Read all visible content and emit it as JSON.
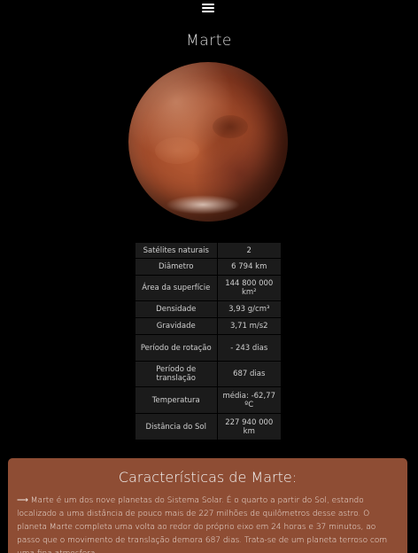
{
  "header": {
    "menu_icon": "hamburger-menu-icon"
  },
  "page": {
    "title": "Marte"
  },
  "planet_image": {
    "alt": "Marte"
  },
  "facts": [
    {
      "label": "Satélites naturais",
      "value": "2"
    },
    {
      "label": "Diâmetro",
      "value": "6 794 km"
    },
    {
      "label": "Área da superfície",
      "value": "144 800 000 km²"
    },
    {
      "label": "Densidade",
      "value": "3,93 g/cm³"
    },
    {
      "label": "Gravidade",
      "value": "3,71 m/s2"
    },
    {
      "label": "Período de rotação",
      "value": "- 243 dias"
    },
    {
      "label": "Período de translação",
      "value": "687 dias"
    },
    {
      "label": "Temperatura",
      "value": "média: -62,77 ºC"
    },
    {
      "label": "Distância do Sol",
      "value": "227 940 000 km"
    }
  ],
  "info": {
    "title": "Características de Marte:",
    "arrow": "⟶",
    "text": "Marte é um dos nove planetas do Sistema Solar. É o quarto a partir do Sol, estando localizado a uma distância de pouco mais de 227 milhões de quilômetros desse astro. O planeta Marte completa uma volta ao redor do próprio eixo em 24 horas e 37 minutos, ao passo que o movimento de translação demora 687 dias. Trata-se de um planeta terroso com uma fina atmosfera"
  },
  "colors": {
    "background": "#000000",
    "info_panel": "#8e4d34",
    "table_cell": "#1b1b1b"
  }
}
